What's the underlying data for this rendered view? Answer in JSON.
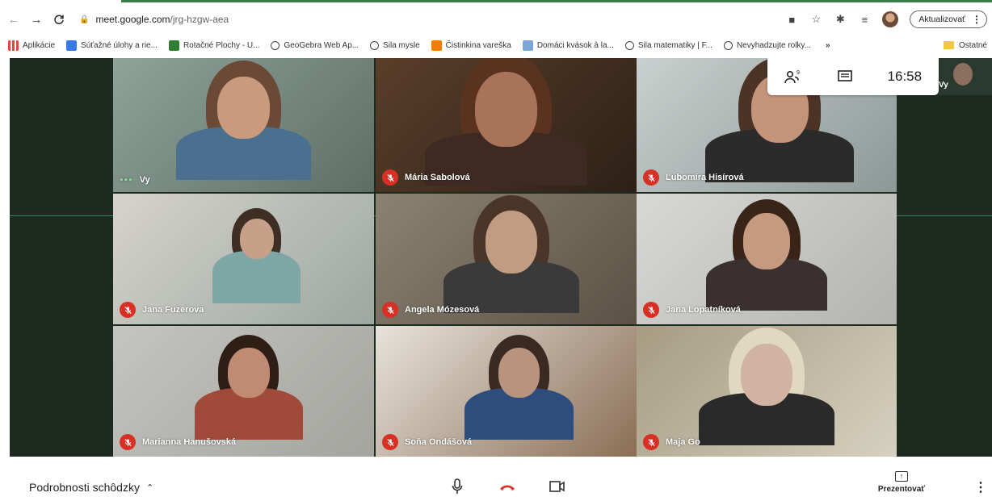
{
  "browser": {
    "url_host": "meet.google.com",
    "url_path": "/jrg-hzgw-aea",
    "update_label": "Aktualizovať"
  },
  "bookmarks": [
    {
      "label": "Aplikácie",
      "icon": "apps-grid-icon",
      "color": "#e8453c"
    },
    {
      "label": "Súťažné úlohy a rie...",
      "icon": "bookmark-favicon-icon",
      "color": "#3b78e7"
    },
    {
      "label": "Rotačné Plochy - U...",
      "icon": "bookmark-favicon-icon",
      "color": "#2e7d32"
    },
    {
      "label": "GeoGebra Web Ap...",
      "icon": "globe-icon",
      "color": "#444444"
    },
    {
      "label": "Sila mysle",
      "icon": "globe-icon",
      "color": "#444444"
    },
    {
      "label": "Čistinkina vareška",
      "icon": "blogger-icon",
      "color": "#f57c00"
    },
    {
      "label": "Domáci kvások à la...",
      "icon": "bookmark-favicon-icon",
      "color": "#7aa7d6"
    },
    {
      "label": "Sila matematiky | F...",
      "icon": "globe-icon",
      "color": "#444444"
    },
    {
      "label": "Nevyhadzujte rolky...",
      "icon": "globe-icon",
      "color": "#444444"
    }
  ],
  "bookmarks_more": "»",
  "bookmarks_other": "Ostatné",
  "meet": {
    "clock": "16:58",
    "self_thumb_label": "Vy",
    "participants": [
      {
        "name": "Vy",
        "muted": false,
        "self": true
      },
      {
        "name": "Mária Sabolová",
        "muted": true
      },
      {
        "name": "Ľubomíra Hisírová",
        "muted": true
      },
      {
        "name": "Jana Fuzerova",
        "muted": true
      },
      {
        "name": "Angela Mózesová",
        "muted": true
      },
      {
        "name": "Jana Lopatníková",
        "muted": true
      },
      {
        "name": "Marianna Hanušovská",
        "muted": true
      },
      {
        "name": "Soňa Ondášová",
        "muted": true
      },
      {
        "name": "Maja Go",
        "muted": true
      }
    ]
  },
  "bottom": {
    "meeting_details": "Podrobnosti schôdzky",
    "present_label": "Prezentovať"
  },
  "colors": {
    "mic_off": "#d93025",
    "hangup": "#d93025",
    "stage_bg": "#1d2a20"
  }
}
